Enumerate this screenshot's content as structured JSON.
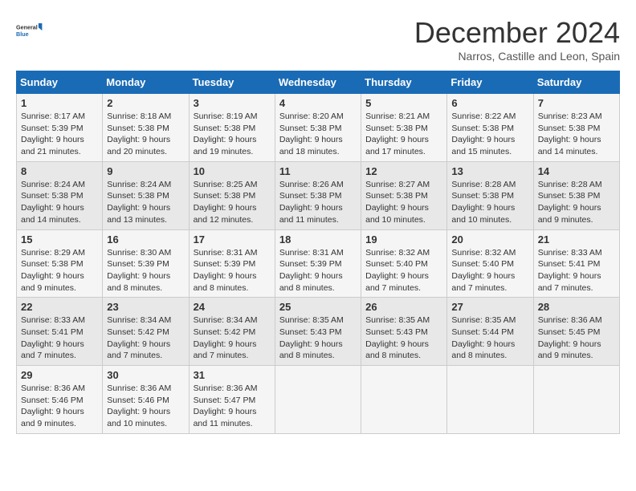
{
  "header": {
    "logo_line1": "General",
    "logo_line2": "Blue",
    "month_title": "December 2024",
    "subtitle": "Narros, Castille and Leon, Spain"
  },
  "weekdays": [
    "Sunday",
    "Monday",
    "Tuesday",
    "Wednesday",
    "Thursday",
    "Friday",
    "Saturday"
  ],
  "weeks": [
    [
      {
        "day": "1",
        "info": "Sunrise: 8:17 AM\nSunset: 5:39 PM\nDaylight: 9 hours and 21 minutes."
      },
      {
        "day": "2",
        "info": "Sunrise: 8:18 AM\nSunset: 5:38 PM\nDaylight: 9 hours and 20 minutes."
      },
      {
        "day": "3",
        "info": "Sunrise: 8:19 AM\nSunset: 5:38 PM\nDaylight: 9 hours and 19 minutes."
      },
      {
        "day": "4",
        "info": "Sunrise: 8:20 AM\nSunset: 5:38 PM\nDaylight: 9 hours and 18 minutes."
      },
      {
        "day": "5",
        "info": "Sunrise: 8:21 AM\nSunset: 5:38 PM\nDaylight: 9 hours and 17 minutes."
      },
      {
        "day": "6",
        "info": "Sunrise: 8:22 AM\nSunset: 5:38 PM\nDaylight: 9 hours and 15 minutes."
      },
      {
        "day": "7",
        "info": "Sunrise: 8:23 AM\nSunset: 5:38 PM\nDaylight: 9 hours and 14 minutes."
      }
    ],
    [
      {
        "day": "8",
        "info": "Sunrise: 8:24 AM\nSunset: 5:38 PM\nDaylight: 9 hours and 14 minutes."
      },
      {
        "day": "9",
        "info": "Sunrise: 8:24 AM\nSunset: 5:38 PM\nDaylight: 9 hours and 13 minutes."
      },
      {
        "day": "10",
        "info": "Sunrise: 8:25 AM\nSunset: 5:38 PM\nDaylight: 9 hours and 12 minutes."
      },
      {
        "day": "11",
        "info": "Sunrise: 8:26 AM\nSunset: 5:38 PM\nDaylight: 9 hours and 11 minutes."
      },
      {
        "day": "12",
        "info": "Sunrise: 8:27 AM\nSunset: 5:38 PM\nDaylight: 9 hours and 10 minutes."
      },
      {
        "day": "13",
        "info": "Sunrise: 8:28 AM\nSunset: 5:38 PM\nDaylight: 9 hours and 10 minutes."
      },
      {
        "day": "14",
        "info": "Sunrise: 8:28 AM\nSunset: 5:38 PM\nDaylight: 9 hours and 9 minutes."
      }
    ],
    [
      {
        "day": "15",
        "info": "Sunrise: 8:29 AM\nSunset: 5:38 PM\nDaylight: 9 hours and 9 minutes."
      },
      {
        "day": "16",
        "info": "Sunrise: 8:30 AM\nSunset: 5:39 PM\nDaylight: 9 hours and 8 minutes."
      },
      {
        "day": "17",
        "info": "Sunrise: 8:31 AM\nSunset: 5:39 PM\nDaylight: 9 hours and 8 minutes."
      },
      {
        "day": "18",
        "info": "Sunrise: 8:31 AM\nSunset: 5:39 PM\nDaylight: 9 hours and 8 minutes."
      },
      {
        "day": "19",
        "info": "Sunrise: 8:32 AM\nSunset: 5:40 PM\nDaylight: 9 hours and 7 minutes."
      },
      {
        "day": "20",
        "info": "Sunrise: 8:32 AM\nSunset: 5:40 PM\nDaylight: 9 hours and 7 minutes."
      },
      {
        "day": "21",
        "info": "Sunrise: 8:33 AM\nSunset: 5:41 PM\nDaylight: 9 hours and 7 minutes."
      }
    ],
    [
      {
        "day": "22",
        "info": "Sunrise: 8:33 AM\nSunset: 5:41 PM\nDaylight: 9 hours and 7 minutes."
      },
      {
        "day": "23",
        "info": "Sunrise: 8:34 AM\nSunset: 5:42 PM\nDaylight: 9 hours and 7 minutes."
      },
      {
        "day": "24",
        "info": "Sunrise: 8:34 AM\nSunset: 5:42 PM\nDaylight: 9 hours and 7 minutes."
      },
      {
        "day": "25",
        "info": "Sunrise: 8:35 AM\nSunset: 5:43 PM\nDaylight: 9 hours and 8 minutes."
      },
      {
        "day": "26",
        "info": "Sunrise: 8:35 AM\nSunset: 5:43 PM\nDaylight: 9 hours and 8 minutes."
      },
      {
        "day": "27",
        "info": "Sunrise: 8:35 AM\nSunset: 5:44 PM\nDaylight: 9 hours and 8 minutes."
      },
      {
        "day": "28",
        "info": "Sunrise: 8:36 AM\nSunset: 5:45 PM\nDaylight: 9 hours and 9 minutes."
      }
    ],
    [
      {
        "day": "29",
        "info": "Sunrise: 8:36 AM\nSunset: 5:46 PM\nDaylight: 9 hours and 9 minutes."
      },
      {
        "day": "30",
        "info": "Sunrise: 8:36 AM\nSunset: 5:46 PM\nDaylight: 9 hours and 10 minutes."
      },
      {
        "day": "31",
        "info": "Sunrise: 8:36 AM\nSunset: 5:47 PM\nDaylight: 9 hours and 11 minutes."
      },
      null,
      null,
      null,
      null
    ]
  ]
}
